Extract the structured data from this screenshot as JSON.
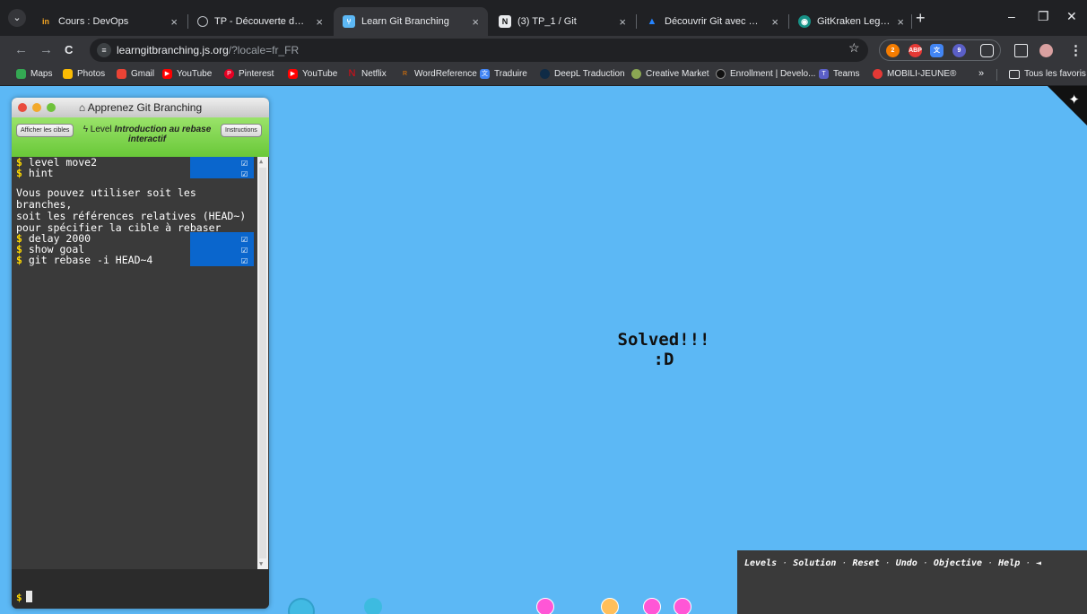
{
  "tabs": [
    {
      "title": "Cours : DevOps",
      "favicon": "in-logo-icon",
      "close": "×"
    },
    {
      "title": "TP - Découverte de Git",
      "favicon": "globe-icon",
      "close": "×"
    },
    {
      "title": "Learn Git Branching",
      "favicon": "git-branching-icon",
      "close": "×"
    },
    {
      "title": "(3) TP_1 / Git",
      "favicon": "notion-icon",
      "close": "×"
    },
    {
      "title": "Découvrir Git avec Bitbucket",
      "favicon": "atlassian-icon",
      "close": "×"
    },
    {
      "title": "GitKraken Legendary Git Too",
      "favicon": "gitkraken-icon",
      "close": "×"
    }
  ],
  "tab_menu": "⌄",
  "new_tab": "+",
  "window_controls": {
    "minimize": "–",
    "restore": "❐",
    "close": "✕"
  },
  "toolbar": {
    "back": "←",
    "forward": "→",
    "reload": "C",
    "site_info_icon": "tune-icon",
    "url_host": "learngitbranching.js.org",
    "url_path": "/?locale=fr_FR",
    "star": "☆"
  },
  "bookmarks": [
    {
      "label": "Maps",
      "icon": "maps-icon",
      "color": "#34a853"
    },
    {
      "label": "Photos",
      "icon": "photos-icon",
      "color": "#fbbc04"
    },
    {
      "label": "Gmail",
      "icon": "gmail-icon",
      "color": "#ea4335"
    },
    {
      "label": "YouTube",
      "icon": "youtube-icon",
      "color": "#ff0000"
    },
    {
      "label": "Pinterest",
      "icon": "pinterest-icon",
      "color": "#e60023"
    },
    {
      "label": "YouTube",
      "icon": "youtube-icon",
      "color": "#ff0000"
    },
    {
      "label": "Netflix",
      "icon": "netflix-icon",
      "color": "#e50914"
    },
    {
      "label": "WordReference",
      "icon": "wordreference-icon",
      "color": "#f57c00"
    },
    {
      "label": "Traduire",
      "icon": "translate-icon",
      "color": "#4285f4"
    },
    {
      "label": "DeepL Traduction",
      "icon": "deepl-icon",
      "color": "#0f2b46"
    },
    {
      "label": "Creative Market",
      "icon": "creative-market-icon",
      "color": "#8ba753"
    },
    {
      "label": "Enrollment | Develo...",
      "icon": "enrollment-icon",
      "color": "#111111"
    },
    {
      "label": "Teams",
      "icon": "teams-icon",
      "color": "#5b5fc7"
    },
    {
      "label": "MOBILI-JEUNE®",
      "icon": "mobili-jeune-icon",
      "color": "#e53935"
    }
  ],
  "bookmarks_more": "»",
  "all_bookmarks": "Tous les favoris",
  "app": {
    "window_title": "Apprenez Git Branching",
    "btn_targets": "Afficher les cibles",
    "level_prefix": "Level",
    "level_name": "Introduction au rebase interactif",
    "btn_instructions": "Instructions"
  },
  "terminal": {
    "prompt": "$",
    "commands_top": [
      "level move2",
      "hint"
    ],
    "hint_lines": [
      "Vous pouvez utiliser soit les branches,",
      "soit les références relatives (HEAD~)",
      "pour spécifier la cible à rebaser"
    ],
    "commands_bottom": [
      "delay 2000",
      "show goal",
      "git rebase -i HEAD~4"
    ],
    "check": "☑"
  },
  "result": {
    "line1": "Solved!!!",
    "line2": ":D"
  },
  "menu": {
    "items": [
      "Levels",
      "Solution",
      "Reset",
      "Undo",
      "Objective",
      "Help"
    ],
    "separator": "·",
    "exit": "⇥"
  },
  "colors": {
    "page_bg": "#5cb8f5",
    "terminal_bg": "#3a3a3a",
    "prompt": "#ffd900",
    "command_highlight": "#0a66cd",
    "title_green": "#69c838",
    "node_pink": "#ff56d6",
    "node_orange": "#ffbf5a",
    "node_teal": "#3dbbe0"
  }
}
